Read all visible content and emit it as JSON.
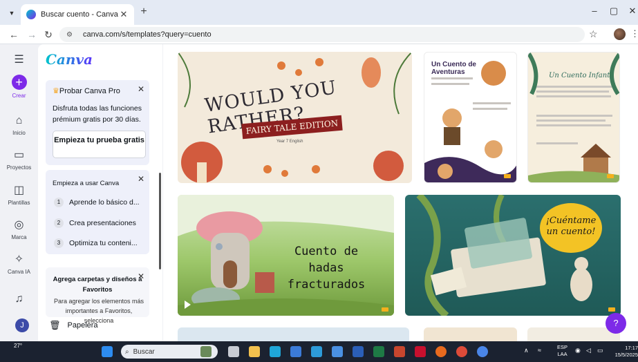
{
  "browser": {
    "tab_title": "Buscar cuento - Canva",
    "tab_close": "✕",
    "new_tab": "+",
    "url": "canva.com/s/templates?query=cuento",
    "minimize": "–",
    "restore": "▢",
    "close": "✕"
  },
  "rail": {
    "create": "Crear",
    "home": "Inicio",
    "projects": "Proyectos",
    "templates": "Plantillas",
    "brand": "Marca",
    "ai": "Canva IA",
    "avatar_initial": "J"
  },
  "panel": {
    "logo": "Canva",
    "pro_card": {
      "title": "Probar Canva Pro",
      "description": "Disfruta todas las funciones prémium gratis por 30 días.",
      "button": "Empieza tu prueba gratis"
    },
    "start_card": {
      "title": "Empieza a usar Canva",
      "items": [
        {
          "num": "1",
          "label": "Aprende lo básico d..."
        },
        {
          "num": "2",
          "label": "Crea presentaciones"
        },
        {
          "num": "3",
          "label": "Optimiza tu conteni..."
        }
      ]
    },
    "fav_card": {
      "title": "Agrega carpetas y diseños a Favoritos",
      "description": "Para agregar los elementos más importantes a Favoritos, selecciona"
    },
    "trash": "Papelera"
  },
  "templates": {
    "wyr_title": "WOULD YOU RATHER?",
    "wyr_ribbon": "FAIRY TALE EDITION",
    "wyr_sub": "Year 7 English",
    "aventuras_title": "Un Cuento de Aventuras",
    "infantil_title": "Un Cuento Infantil",
    "hadas_title": "Cuento de hadas fracturados",
    "cuentame": "¡Cuéntame un cuento!"
  },
  "help": "?",
  "taskbar": {
    "weather": "27°",
    "search": "Buscar",
    "lang_top": "ESP",
    "lang_bottom": "LAA",
    "time": "17:17",
    "date": "15/5/2025"
  }
}
